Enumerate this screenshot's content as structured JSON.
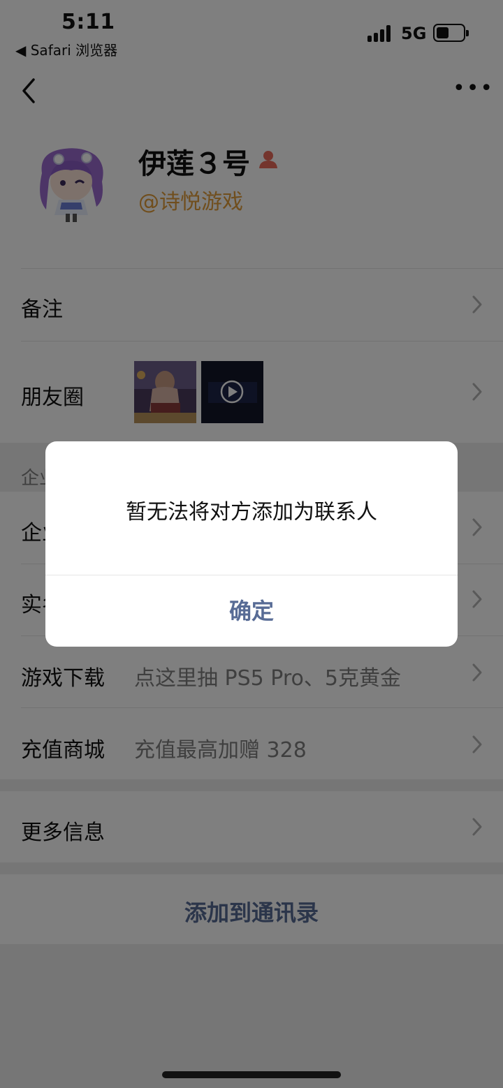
{
  "status_bar": {
    "time": "5:11",
    "back_app": "◀ Safari 浏览器",
    "network": "5G",
    "battery_level": 0.45
  },
  "nav": {
    "back_icon": "chevron-left-icon",
    "more_icon": "more-dots-icon",
    "more_label": "•••"
  },
  "profile": {
    "name": "伊莲３号",
    "org": "@诗悦游戏",
    "badge_icon": "person-icon",
    "badge_color": "#e86b5a"
  },
  "rows": {
    "remark": {
      "label": "备注"
    },
    "moments": {
      "label": "朋友圈"
    },
    "enterprise_section_label": "企业",
    "enterprise": {
      "label": "企业"
    },
    "real_name": {
      "label": "实名"
    },
    "game_download": {
      "label": "游戏下载",
      "value": "点这里抽 PS5 Pro、5克黄金"
    },
    "recharge_mall": {
      "label": "充值商城",
      "value": "充值最高加赠 328"
    },
    "more_info": {
      "label": "更多信息"
    }
  },
  "add_contact_button": "添加到通讯录",
  "dialog": {
    "message": "暂无法将对方添加为联系人",
    "confirm": "确定"
  },
  "colors": {
    "link": "#576b95",
    "org": "#e19c3a",
    "overlay": "rgba(0,0,0,0.5)"
  }
}
